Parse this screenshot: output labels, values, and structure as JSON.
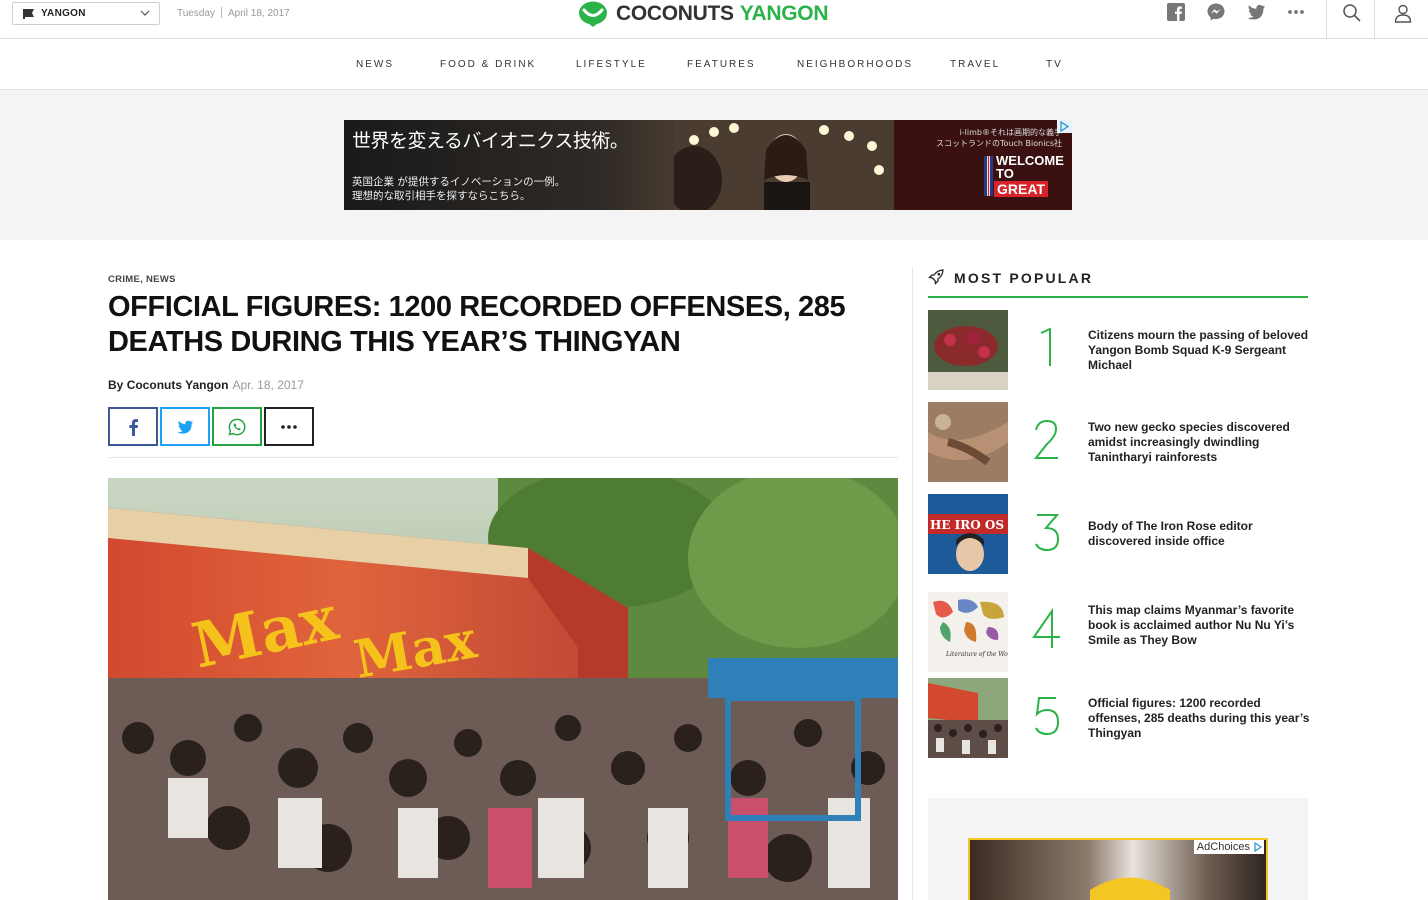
{
  "topbar": {
    "city": "YANGON",
    "day": "Tuesday",
    "date": "April 18, 2017",
    "logo_word1": "COCONUTS",
    "logo_word2": "YANGON"
  },
  "nav": {
    "items": [
      "NEWS",
      "FOOD & DRINK",
      "LIFESTYLE",
      "FEATURES",
      "NEIGHBORHOODS",
      "TRAVEL",
      "TV"
    ]
  },
  "ad": {
    "headline": "世界を変えるバイオニクス技術。",
    "sub1": "英国企業 が提供するイノベーションの一例。",
    "sub2": "理想的な取引相手を探すならこちら。",
    "small1": "i-limb®それは画期的な義手",
    "small2": "スコットランドのTouch Bionics社",
    "welcome": "WELCOME",
    "to": "TO",
    "great": "GREAT"
  },
  "article": {
    "categories": [
      "CRIME",
      "NEWS"
    ],
    "headline": "Official figures: 1200 recorded offenses, 285 deaths during this year’s Thingyan",
    "byline_prefix": "By",
    "author": "Coconuts Yangon",
    "date": "Apr. 18, 2017"
  },
  "sidebar": {
    "most_popular_title": "MOST POPULAR",
    "items": [
      {
        "rank": "1",
        "title": "Citizens mourn the passing of beloved Yangon Bomb Squad K-9 Sergeant Michael"
      },
      {
        "rank": "2",
        "title": "Two new gecko species discovered amidst increasingly dwindling Tanintharyi rainforests"
      },
      {
        "rank": "3",
        "title": "Body of The Iron Rose editor discovered inside office"
      },
      {
        "rank": "4",
        "title": "This map claims Myanmar’s favorite book is acclaimed author Nu Nu Yi’s Smile as They Bow"
      },
      {
        "rank": "5",
        "title": "Official figures: 1200 recorded offenses, 285 deaths during this year’s Thingyan"
      }
    ],
    "ad_choices_label": "AdChoices"
  },
  "colors": {
    "brand_green": "#2bb34a",
    "facebook": "#3b5998",
    "twitter": "#1da1f2",
    "whatsapp": "#25a244"
  }
}
